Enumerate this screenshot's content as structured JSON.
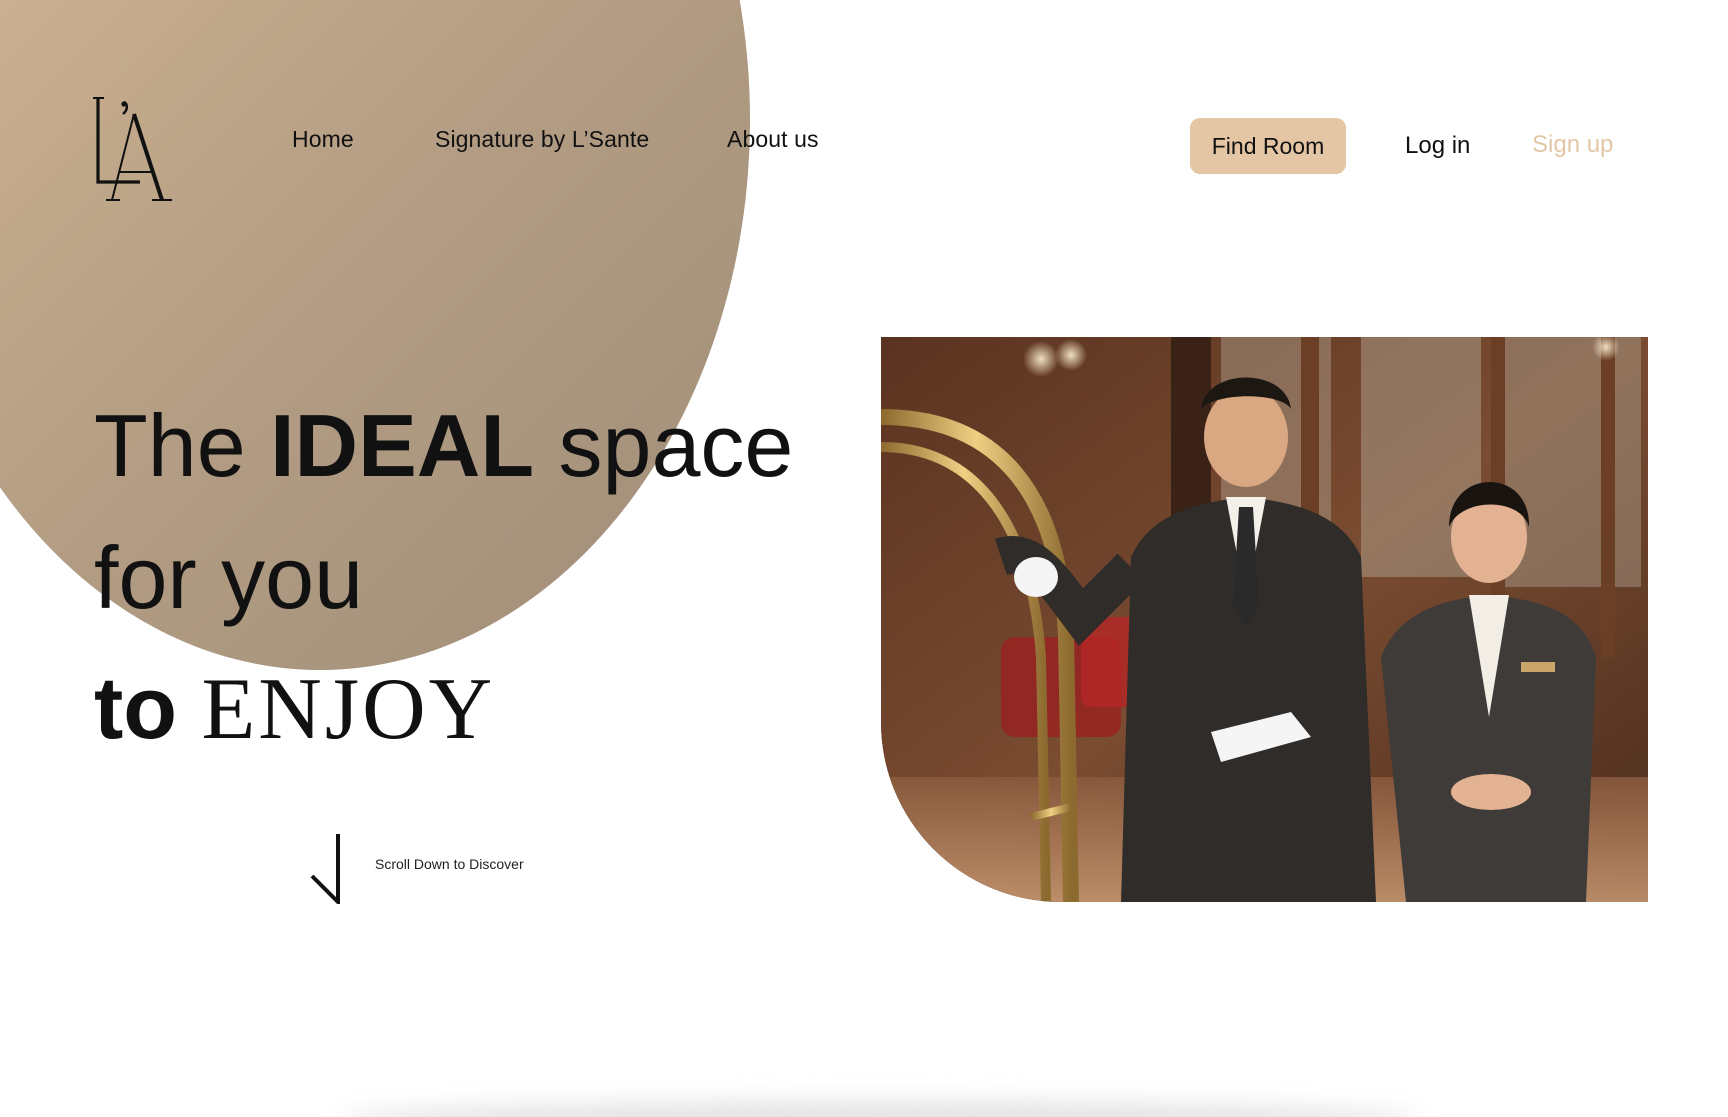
{
  "brand": {
    "logo_name": "L'A monogram",
    "accent_color": "#e4c6a4",
    "blob_gradient": [
      "#e6c8a4",
      "#a08d78"
    ]
  },
  "nav": {
    "items": [
      {
        "label": "Home"
      },
      {
        "label": "Signature by L’Sante"
      },
      {
        "label": "About us"
      }
    ],
    "find_room": "Find Room",
    "login": "Log in",
    "signup": "Sign up"
  },
  "hero": {
    "line1_a": "The ",
    "line1_b": "IDEAL",
    "line1_c": " space",
    "line2": "for you",
    "line3_a": "to ",
    "line3_b": "ENJOY",
    "scroll_label": "Scroll Down to Discover",
    "scroll_icon": "arrow-down-icon"
  },
  "image": {
    "subject": "hotel-staff-photo"
  }
}
